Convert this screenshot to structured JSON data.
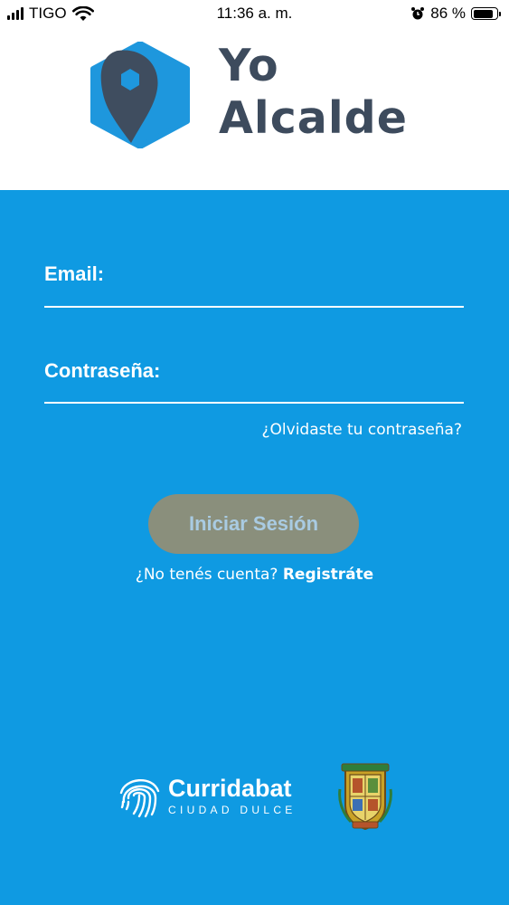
{
  "status_bar": {
    "carrier": "TIGO",
    "time": "11:36 a. m.",
    "battery_percent": "86 %",
    "battery_level": 0.86
  },
  "app": {
    "logo_line1": "Yo",
    "logo_line2": "Alcalde"
  },
  "form": {
    "email_label": "Email:",
    "email_value": "",
    "password_label": "Contraseña:",
    "password_value": "",
    "forgot_password": "¿Olvidaste tu contraseña?",
    "login_button": "Iniciar Sesión",
    "no_account": "¿No tenés cuenta?",
    "register_link": "Registráte"
  },
  "footer": {
    "municipality_name": "Curridabat",
    "municipality_tagline": "CIUDAD DULCE"
  },
  "colors": {
    "background": "#0f9ae2",
    "header_bg": "#ffffff",
    "logo_text": "#3d4b5d",
    "logo_hex": "#1e97dd",
    "logo_pin": "#3f4d5f",
    "button_bg": "#8a8f7c",
    "button_text": "#a9cbe2"
  }
}
